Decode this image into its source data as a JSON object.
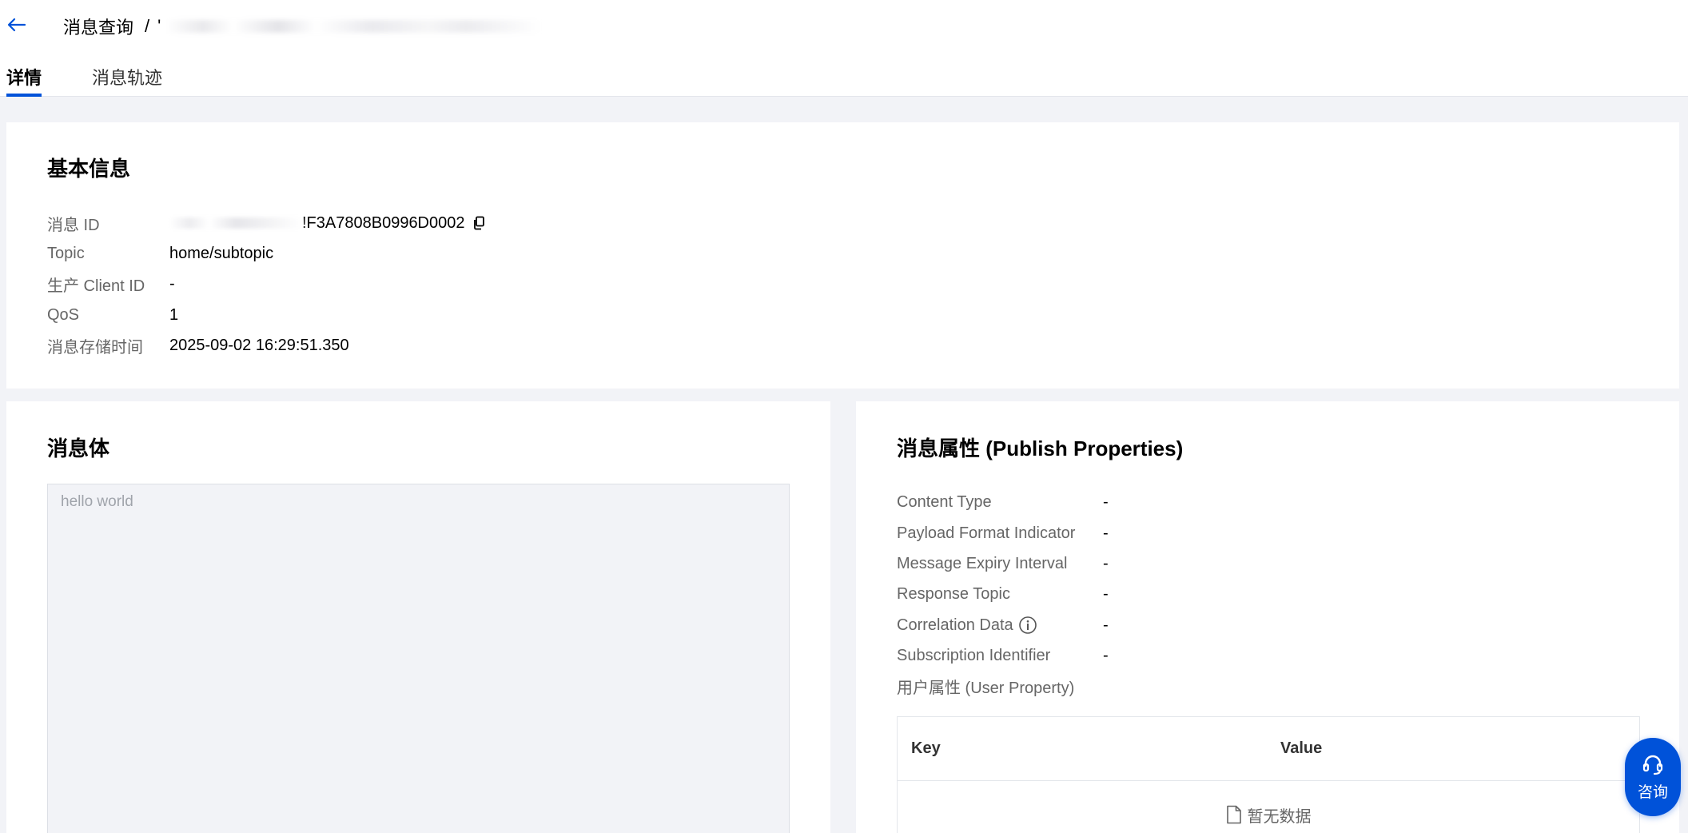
{
  "header": {
    "breadcrumb_root": "消息查询",
    "breadcrumb_separator": "/",
    "breadcrumb_current": "'"
  },
  "tabs": [
    {
      "label": "详情",
      "active": true
    },
    {
      "label": "消息轨迹",
      "active": false
    }
  ],
  "basic_info": {
    "title": "基本信息",
    "fields": [
      {
        "label": "消息 ID",
        "value": "!F3A7808B0996D0002"
      },
      {
        "label": "Topic",
        "value": "home/subtopic"
      },
      {
        "label": "生产 Client ID",
        "value": "-"
      },
      {
        "label": "QoS",
        "value": "1"
      },
      {
        "label": "消息存储时间",
        "value": "2025-09-02 16:29:51.350"
      }
    ]
  },
  "message_body": {
    "title": "消息体",
    "content": "hello world"
  },
  "properties": {
    "title": "消息属性 (Publish Properties)",
    "fields": [
      {
        "label": "Content Type",
        "value": "-"
      },
      {
        "label": "Payload Format Indicator",
        "value": "-"
      },
      {
        "label": "Message Expiry Interval",
        "value": "-"
      },
      {
        "label": "Response Topic",
        "value": "-"
      },
      {
        "label": "Correlation Data",
        "value": "-",
        "icon": "info-icon"
      },
      {
        "label": "Subscription Identifier",
        "value": "-"
      }
    ],
    "user_property_label": "用户属性 (User Property)",
    "table": {
      "columns": [
        "Key",
        "Value"
      ],
      "empty_text": "暂无数据"
    }
  },
  "consult_button": {
    "label": "咨询",
    "icon": "headset-icon"
  },
  "colors": {
    "accent": "#0052d9",
    "background": "#f2f3f7",
    "card": "#ffffff"
  }
}
